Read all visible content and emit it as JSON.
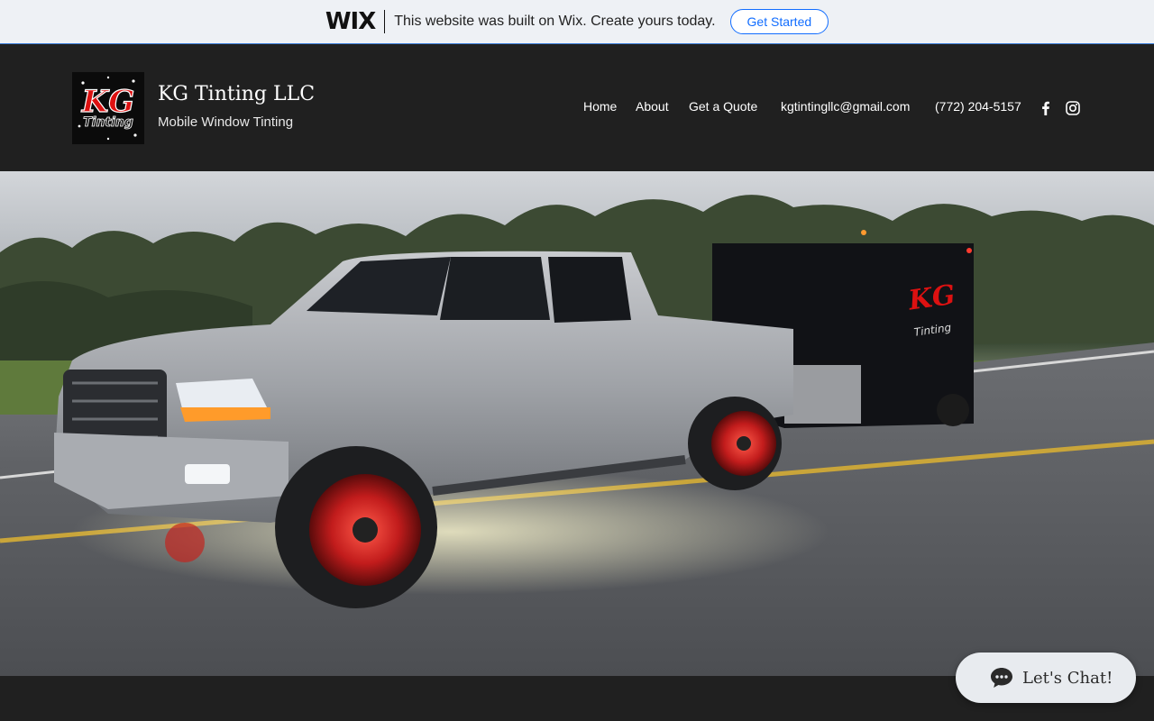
{
  "wix_banner": {
    "logo": "WIX",
    "message": "This website was built on Wix. Create yours today.",
    "cta_label": "Get Started"
  },
  "site": {
    "title": "KG Tinting LLC",
    "tagline": "Mobile Window Tinting",
    "logo_text": "KG Tinting"
  },
  "nav": {
    "items": [
      "Home",
      "About",
      "Get a Quote"
    ],
    "email": "kgtintingllc@gmail.com",
    "phone": "(772) 204-5157"
  },
  "social": [
    "facebook-icon",
    "instagram-icon"
  ],
  "chat": {
    "label": "Let's Chat!"
  },
  "colors": {
    "header_bg": "#202020",
    "wix_blue": "#116dff",
    "banner_bg": "#eef1f5"
  }
}
